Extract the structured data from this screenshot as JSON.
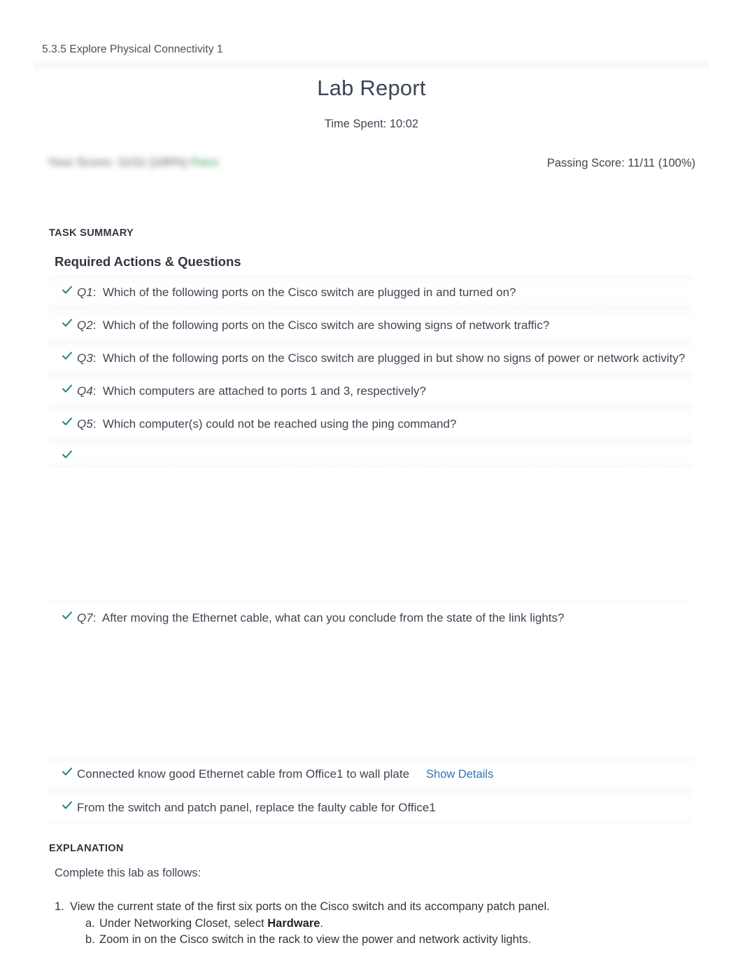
{
  "header": {
    "breadcrumb": "5.3.5 Explore Physical Connectivity 1",
    "title": "Lab Report",
    "time_spent": "Time Spent: 10:02"
  },
  "score": {
    "your_score_redacted": "Your Score: 11/11 (100%)",
    "your_score_redacted_status": "Pass",
    "passing_score": "Passing Score: 11/11 (100%)"
  },
  "task_summary": {
    "section_label": "TASK SUMMARY",
    "subsection_title": "Required Actions & Questions",
    "rows": [
      {
        "qlabel": "Q1",
        "text": "Which of the following ports on the Cisco switch are plugged in and turned on?"
      },
      {
        "qlabel": "Q2",
        "text": "Which of the following ports on the Cisco switch are showing signs of network traffic?"
      },
      {
        "qlabel": "Q3",
        "text": "Which of the following ports on the Cisco switch are plugged in but show no signs of power or network activity?"
      },
      {
        "qlabel": "Q4",
        "text": "Which computers are attached to ports 1 and 3, respectively?"
      },
      {
        "qlabel": "Q5",
        "text": "Which computer(s) could not be reached using the ping command?"
      },
      {
        "qlabel": "",
        "text": ""
      },
      {
        "qlabel": "Q7",
        "text": "After moving the Ethernet cable, what can you conclude from the state of the link lights?"
      },
      {
        "qlabel": "",
        "text": "Connected know good Ethernet cable from Office1 to wall plate",
        "link_label": "Show Details"
      },
      {
        "qlabel": "",
        "text": "From the switch and patch panel, replace the faulty cable for Office1"
      }
    ]
  },
  "explanation": {
    "section_label": "EXPLANATION",
    "intro": "Complete this lab as follows:",
    "steps": [
      {
        "num": "1.",
        "text": "View the current state of the first six ports on the Cisco switch and its accompany patch panel.",
        "substeps": [
          {
            "num": "a.",
            "prefix": "Under Networking Closet, select ",
            "bold": "Hardware",
            "suffix": "."
          },
          {
            "num": "b.",
            "prefix": "Zoom in on the Cisco switch in the rack to view the power and network activity lights.",
            "bold": "",
            "suffix": ""
          }
        ]
      }
    ]
  },
  "colors": {
    "check": "#17867f",
    "link": "#3174b0",
    "title": "#3b4557",
    "pass_green": "#4ca96a"
  }
}
